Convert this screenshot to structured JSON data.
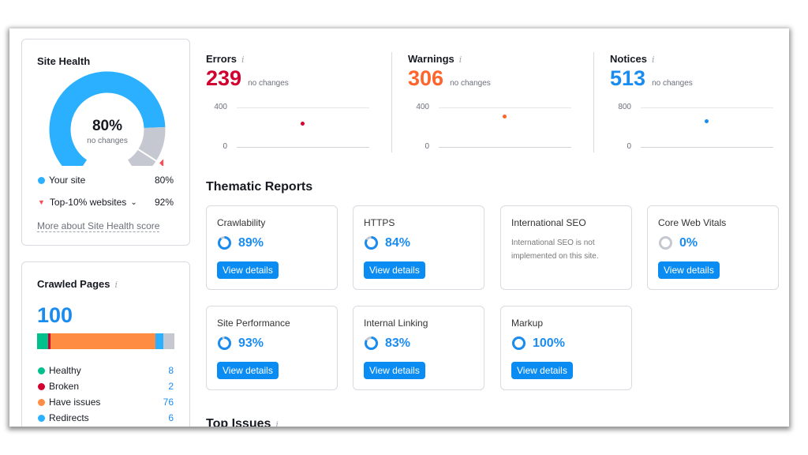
{
  "site_health": {
    "title": "Site Health",
    "value": 80,
    "value_label": "80%",
    "change": "no changes",
    "top10": 92,
    "legend": [
      {
        "label": "Your site",
        "value": "80%"
      },
      {
        "label": "Top-10% websites",
        "value": "92%"
      }
    ],
    "link": "More about Site Health score",
    "colors": {
      "site": "#2bb0ff",
      "rest": "#c5c8d0",
      "marker": "#ff4953"
    }
  },
  "crawled": {
    "title": "Crawled Pages",
    "info": "i",
    "total": "100",
    "items": [
      {
        "label": "Healthy",
        "value": 8,
        "color": "#00c08b"
      },
      {
        "label": "Broken",
        "value": 2,
        "color": "#d1002f"
      },
      {
        "label": "Have issues",
        "value": 76,
        "color": "#ff8c43"
      },
      {
        "label": "Redirects",
        "value": 6,
        "color": "#2bb0ff"
      }
    ],
    "rest_color": "#c5c8d0"
  },
  "metrics": [
    {
      "title": "Errors",
      "info": "i",
      "value": "239",
      "num": 239,
      "change": "no changes",
      "color": "#d1002f",
      "ymax": 400,
      "ticks": [
        "400",
        "0"
      ]
    },
    {
      "title": "Warnings",
      "info": "i",
      "value": "306",
      "num": 306,
      "change": "no changes",
      "color": "#ff642d",
      "ymax": 400,
      "ticks": [
        "400",
        "0"
      ]
    },
    {
      "title": "Notices",
      "info": "i",
      "value": "513",
      "num": 513,
      "change": "no changes",
      "color": "#1a8cf0",
      "ymax": 800,
      "ticks": [
        "800",
        "0"
      ]
    }
  ],
  "thematic": {
    "title": "Thematic Reports",
    "button": "View details",
    "cards": [
      {
        "title": "Crawlability",
        "pct": 89,
        "label": "89%"
      },
      {
        "title": "HTTPS",
        "pct": 84,
        "label": "84%"
      },
      {
        "title": "International SEO",
        "desc": "International SEO is not implemented on this site."
      },
      {
        "title": "Core Web Vitals",
        "pct": 0,
        "label": "0%"
      },
      {
        "title": "Site Performance",
        "pct": 93,
        "label": "93%"
      },
      {
        "title": "Internal Linking",
        "pct": 83,
        "label": "83%"
      },
      {
        "title": "Markup",
        "pct": 100,
        "label": "100%"
      }
    ]
  },
  "top_issues": {
    "title": "Top Issues",
    "info": "i"
  }
}
